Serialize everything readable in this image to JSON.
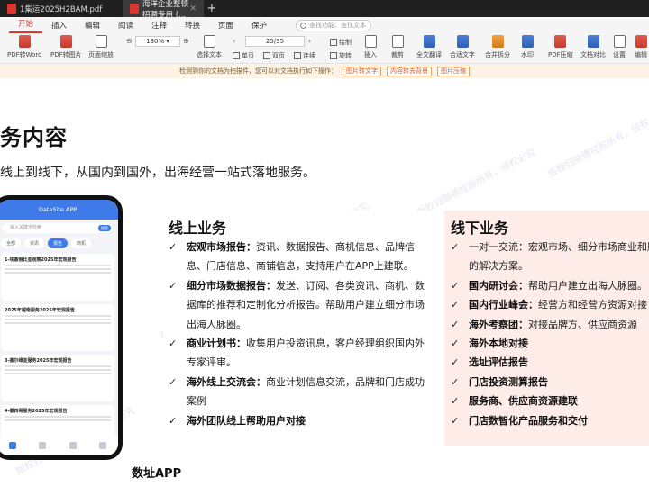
{
  "tabs": [
    {
      "title": "1集运2025H2BAM.pdf"
    },
    {
      "title": "海洋企业整顿 招聘专用 (..."
    }
  ],
  "menu": {
    "items": [
      "开始",
      "插入",
      "编辑",
      "阅读",
      "注释",
      "转换",
      "页面",
      "保护"
    ],
    "search_placeholder": "查找功能、查找文本"
  },
  "toolbar": {
    "pdf_to_word": "PDF转Word",
    "pdf_to_image": "PDF转图片",
    "page_zoom": "页面缩放",
    "zoom_value": "130%",
    "page_value": "25/35",
    "translate_text": "全文翻译",
    "text_fit": "合适文字",
    "merge_files": "合并拆分",
    "watermark": "水印",
    "compress": "PDF压缩",
    "file_convert": "文档对比",
    "settings": "设置",
    "insert": "插入",
    "crop": "裁剪",
    "select_text": "选择文本",
    "single_page": "单页",
    "double_page": "双页",
    "continuous": "连续",
    "rotate": "旋转",
    "draw": "绘制",
    "edit": "编辑"
  },
  "notification": {
    "message": "检测到你的文档为扫描件，您可以对文档执行如下操作：",
    "btn_ocr": "图片转文字",
    "btn_bg": "内容转去背景",
    "btn_compress": "图片压缩"
  },
  "document": {
    "title": "务内容",
    "subtitle": "线上到线下，从国内到国外，出海经营一站式落地服务。",
    "app_caption": "数址APP",
    "watermark": "版权归融德控股所有，侵权必究"
  },
  "phone": {
    "header": "DataSite APP",
    "search_placeholder": "输入关键字检索",
    "search_btn": "搜索",
    "chips": [
      "全部",
      "资讯",
      "报告",
      "商机"
    ],
    "cards": [
      {
        "title": "1-埃塞俄比亚观察2025年宏观报告"
      },
      {
        "title": "2025年越南服务2025年宏观报告"
      },
      {
        "title": "3-塞尔维亚服务2025年宏观报告"
      },
      {
        "title": "4-墨西哥服务2025年宏观报告"
      }
    ]
  },
  "online": {
    "title": "线上业务",
    "items": [
      {
        "bold": "宏观市场报告：",
        "text": "资讯、数据报告、商机信息、品牌信息、门店信息、商铺信息，支持用户在APP上建联。"
      },
      {
        "bold": "细分市场数据报告：",
        "text": "发送、订阅、各类资讯、商机、数据库的推荐和定制化分析报告。帮助用户建立细分市场出海人脉圈。"
      },
      {
        "bold": "商业计划书：",
        "text": "收集用户投资讯息，客户经理组织国内外专家评审。"
      },
      {
        "bold": "海外线上交流会：",
        "text": "商业计划信息交流，品牌和门店成功案例"
      },
      {
        "bold": "海外团队线上帮助用户对接",
        "text": ""
      }
    ]
  },
  "offline": {
    "title": "线下业务",
    "items": [
      {
        "bold": "",
        "text": "一对一交流：宏观市场、细分市场商业和顾虑的解决方案。"
      },
      {
        "bold": "国内研讨会：",
        "text": "帮助用户建立出海人脉圈。"
      },
      {
        "bold": "国内行业峰会：",
        "text": "经营方和经营方资源对接"
      },
      {
        "bold": "海外考察团：",
        "text": "对接品牌方、供应商资源"
      },
      {
        "bold": "海外本地对接",
        "text": ""
      },
      {
        "bold": "选址评估报告",
        "text": ""
      },
      {
        "bold": "门店投资测算报告",
        "text": ""
      },
      {
        "bold": "服务商、供应商资源建联",
        "text": ""
      },
      {
        "bold": "门店数智化产品服务和交付",
        "text": ""
      }
    ]
  }
}
